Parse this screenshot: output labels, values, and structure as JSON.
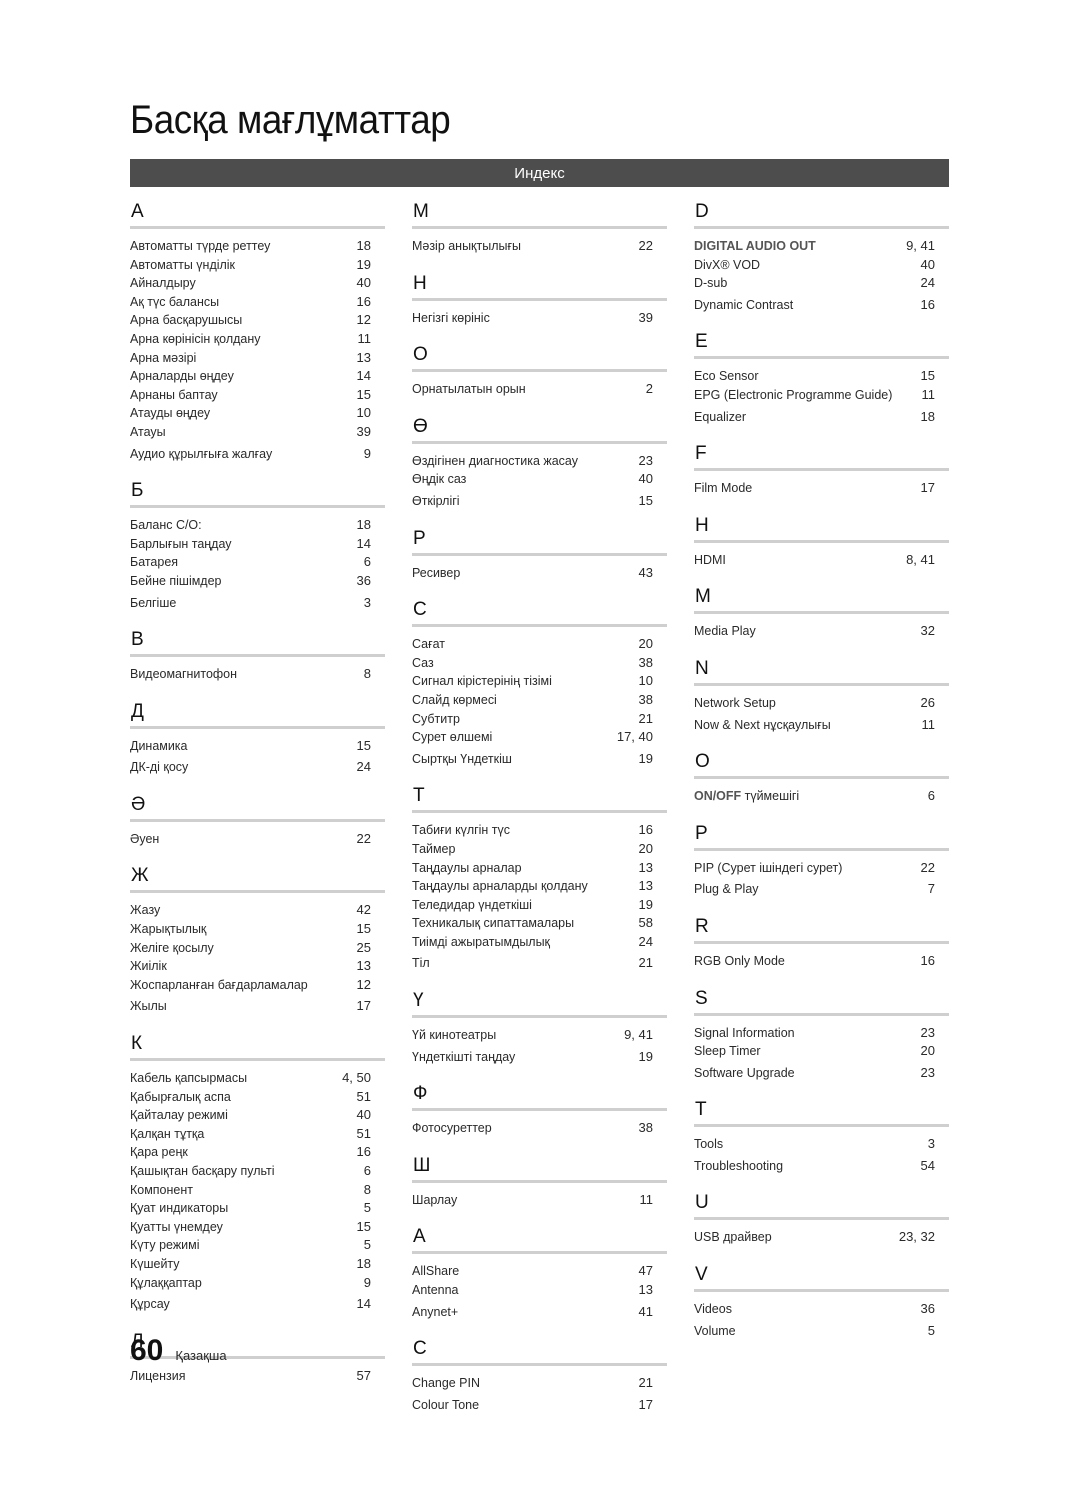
{
  "title": "Басқа мағлұматтар",
  "index_label": "Индекс",
  "footer": {
    "page_number": "60",
    "language": "Қазақша"
  },
  "columns": [
    {
      "sections": [
        {
          "letter": "А",
          "entries": [
            {
              "term": "Автоматты түрде реттеу",
              "pages": "18"
            },
            {
              "term": "Автоматты үнділік",
              "pages": "19"
            },
            {
              "term": "Айналдыру",
              "pages": "40"
            },
            {
              "term": "Ақ түс балансы",
              "pages": "16"
            },
            {
              "term": "Арна басқарушысы",
              "pages": "12"
            },
            {
              "term": "Арна көрінісін қолдану",
              "pages": "11"
            },
            {
              "term": "Арна мәзірі",
              "pages": "13"
            },
            {
              "term": "Арналарды өңдеу",
              "pages": "14"
            },
            {
              "term": "Арнаны баптау",
              "pages": "15"
            },
            {
              "term": "Атауды өңдеу",
              "pages": "10"
            },
            {
              "term": "Атауы",
              "pages": "39"
            },
            {
              "term": "Аудио құрылғыға жалғау",
              "pages": "9"
            }
          ]
        },
        {
          "letter": "Б",
          "entries": [
            {
              "term": "Баланс С/О:",
              "pages": "18"
            },
            {
              "term": "Барлығын таңдау",
              "pages": "14"
            },
            {
              "term": "Батарея",
              "pages": "6"
            },
            {
              "term": "Бейне пішімдер",
              "pages": "36"
            },
            {
              "term": "Белгіше",
              "pages": "3"
            }
          ]
        },
        {
          "letter": "В",
          "entries": [
            {
              "term": "Видеомагнитофон",
              "pages": "8"
            }
          ]
        },
        {
          "letter": "Д",
          "entries": [
            {
              "term": "Динамика",
              "pages": "15"
            },
            {
              "term": "ДК-ді қосу",
              "pages": "24"
            }
          ]
        },
        {
          "letter": "Ә",
          "entries": [
            {
              "term": "Әуен",
              "pages": "22"
            }
          ]
        },
        {
          "letter": "Ж",
          "entries": [
            {
              "term": "Жазу",
              "pages": "42"
            },
            {
              "term": "Жарықтылық",
              "pages": "15"
            },
            {
              "term": "Желіге қосылу",
              "pages": "25"
            },
            {
              "term": "Жиілік",
              "pages": "13"
            },
            {
              "term": "Жоспарланған бағдарламалар",
              "pages": "12"
            },
            {
              "term": "Жылы",
              "pages": "17"
            }
          ]
        },
        {
          "letter": "К",
          "entries": [
            {
              "term": "Кабель қапсырмасы",
              "pages": "4, 50"
            },
            {
              "term": "Қабырғалық аспа",
              "pages": "51"
            },
            {
              "term": "Қайталау режимі",
              "pages": "40"
            },
            {
              "term": "Қалқан тұтқа",
              "pages": "51"
            },
            {
              "term": "Қара реңк",
              "pages": "16"
            },
            {
              "term": "Қашықтан басқару пульті",
              "pages": "6"
            },
            {
              "term": "Компонент",
              "pages": "8"
            },
            {
              "term": "Қуат индикаторы",
              "pages": "5"
            },
            {
              "term": "Қуатты үнемдеу",
              "pages": "15"
            },
            {
              "term": "Күту режимі",
              "pages": "5"
            },
            {
              "term": "Күшейту",
              "pages": "18"
            },
            {
              "term": "Құлаққаптар",
              "pages": "9"
            },
            {
              "term": "Құрсау",
              "pages": "14"
            }
          ]
        },
        {
          "letter": "Л",
          "entries": [
            {
              "term": "Лицензия",
              "pages": "57"
            }
          ]
        }
      ]
    },
    {
      "sections": [
        {
          "letter": "М",
          "entries": [
            {
              "term": "Мәзір анықтылығы",
              "pages": "22"
            }
          ]
        },
        {
          "letter": "Н",
          "entries": [
            {
              "term": "Негізгі көрініс",
              "pages": "39"
            }
          ]
        },
        {
          "letter": "О",
          "entries": [
            {
              "term": "Орнатылатын орын",
              "pages": "2"
            }
          ]
        },
        {
          "letter": "Ө",
          "entries": [
            {
              "term": "Өздігінен диагностика жасау",
              "pages": "23"
            },
            {
              "term": "Өңдік саз",
              "pages": "40"
            },
            {
              "term": "Өткірлігі",
              "pages": "15"
            }
          ]
        },
        {
          "letter": "Р",
          "entries": [
            {
              "term": "Ресивер",
              "pages": "43"
            }
          ]
        },
        {
          "letter": "С",
          "entries": [
            {
              "term": "Сағат",
              "pages": "20"
            },
            {
              "term": "Саз",
              "pages": "38"
            },
            {
              "term": "Сигнал кірістерінің тізімі",
              "pages": "10"
            },
            {
              "term": "Слайд көрмесі",
              "pages": "38"
            },
            {
              "term": "Субтитр",
              "pages": "21"
            },
            {
              "term": "Сурет өлшемі",
              "pages": "17, 40"
            },
            {
              "term": "Сыртқы Үндеткіш",
              "pages": "19"
            }
          ]
        },
        {
          "letter": "Т",
          "entries": [
            {
              "term": "Табиғи күлгін түс",
              "pages": "16"
            },
            {
              "term": "Таймер",
              "pages": "20"
            },
            {
              "term": "Таңдаулы арналар",
              "pages": "13"
            },
            {
              "term": "Таңдаулы арналарды қолдану",
              "pages": "13"
            },
            {
              "term": "Теледидар үндеткіші",
              "pages": "19"
            },
            {
              "term": "Техникалық сипаттамалары",
              "pages": "58"
            },
            {
              "term": "Тиімді ажыратымдылық",
              "pages": "24"
            },
            {
              "term": "Тіл",
              "pages": "21"
            }
          ]
        },
        {
          "letter": "Ү",
          "entries": [
            {
              "term": "Үй кинотеатры",
              "pages": "9, 41"
            },
            {
              "term": "Үндеткішті таңдау",
              "pages": "19"
            }
          ]
        },
        {
          "letter": "Ф",
          "entries": [
            {
              "term": "Фотосуреттер",
              "pages": "38"
            }
          ]
        },
        {
          "letter": "Ш",
          "entries": [
            {
              "term": "Шарлау",
              "pages": "11"
            }
          ]
        },
        {
          "letter": "A",
          "entries": [
            {
              "term": "AllShare",
              "pages": "47"
            },
            {
              "term": "Antenna",
              "pages": "13"
            },
            {
              "term": "Anynet+",
              "pages": "41"
            }
          ]
        },
        {
          "letter": "C",
          "entries": [
            {
              "term": "Change PIN",
              "pages": "21"
            },
            {
              "term": "Colour Tone",
              "pages": "17"
            }
          ]
        }
      ]
    },
    {
      "sections": [
        {
          "letter": "D",
          "entries": [
            {
              "term": "DIGITAL AUDIO OUT",
              "pages": "9, 41",
              "style": "bold"
            },
            {
              "term": "DivX® VOD",
              "pages": "40"
            },
            {
              "term": "D-sub",
              "pages": "24"
            },
            {
              "term": "Dynamic Contrast",
              "pages": "16"
            }
          ]
        },
        {
          "letter": "E",
          "entries": [
            {
              "term": "Eco Sensor",
              "pages": "15"
            },
            {
              "term": "EPG (Electronic Programme Guide)",
              "pages": "11"
            },
            {
              "term": "Equalizer",
              "pages": "18"
            }
          ]
        },
        {
          "letter": "F",
          "entries": [
            {
              "term": "Film Mode",
              "pages": "17"
            }
          ]
        },
        {
          "letter": "H",
          "entries": [
            {
              "term": "HDMI",
              "pages": "8, 41"
            }
          ]
        },
        {
          "letter": "M",
          "entries": [
            {
              "term": "Media Play",
              "pages": "32"
            }
          ]
        },
        {
          "letter": "N",
          "entries": [
            {
              "term": "Network Setup",
              "pages": "26"
            },
            {
              "term": "Now & Next нұсқаулығы",
              "pages": "11"
            }
          ]
        },
        {
          "letter": "O",
          "entries": [
            {
              "term": "түймешігі",
              "bold_prefix": "ON/OFF",
              "pages": "6"
            }
          ]
        },
        {
          "letter": "P",
          "entries": [
            {
              "term": "PIP (Сурет ішіндегі сурет)",
              "pages": "22"
            },
            {
              "term": "Plug & Play",
              "pages": "7"
            }
          ]
        },
        {
          "letter": "R",
          "entries": [
            {
              "term": "RGB Only Mode",
              "pages": "16"
            }
          ]
        },
        {
          "letter": "S",
          "entries": [
            {
              "term": "Signal Information",
              "pages": "23"
            },
            {
              "term": "Sleep Timer",
              "pages": "20"
            },
            {
              "term": "Software Upgrade",
              "pages": "23"
            }
          ]
        },
        {
          "letter": "T",
          "entries": [
            {
              "term": "Tools",
              "pages": "3"
            },
            {
              "term": "Troubleshooting",
              "pages": "54"
            }
          ]
        },
        {
          "letter": "U",
          "entries": [
            {
              "term": "USB драйвер",
              "pages": "23, 32"
            }
          ]
        },
        {
          "letter": "V",
          "entries": [
            {
              "term": "Videos",
              "pages": "36"
            },
            {
              "term": "Volume",
              "pages": "5"
            }
          ]
        }
      ]
    }
  ]
}
